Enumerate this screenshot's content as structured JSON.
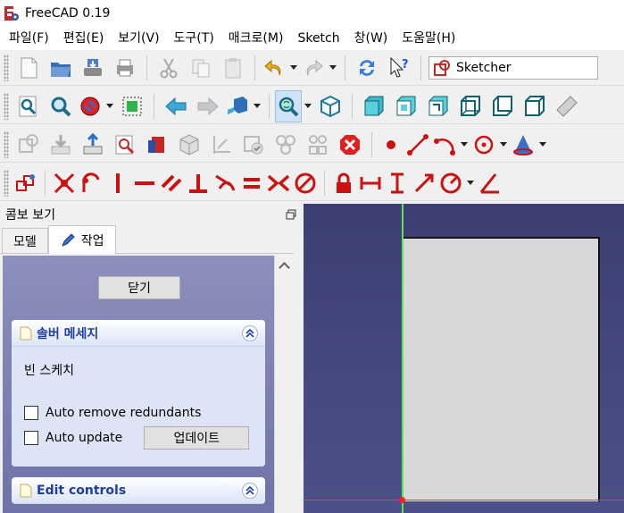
{
  "window": {
    "title": "FreeCAD 0.19"
  },
  "menu": [
    "파일(F)",
    "편집(E)",
    "보기(V)",
    "도구(T)",
    "매크로(M)",
    "Sketch",
    "창(W)",
    "도움말(H)"
  ],
  "workbench": {
    "selected": "Sketcher"
  },
  "combo_view": {
    "title": "콤보 보기",
    "tabs": [
      "모델",
      "작업"
    ],
    "active_tab": "작업"
  },
  "task": {
    "close_label": "닫기",
    "solver": {
      "title": "솔버 메세지",
      "status": "빈 스케치",
      "auto_remove_label": "Auto remove redundants",
      "auto_update_label": "Auto update",
      "update_label": "업데이트"
    },
    "edit_controls": {
      "title": "Edit controls"
    }
  },
  "colors": {
    "sketch_red": "#cc1111",
    "accent_blue": "#1f3ea3",
    "viewport_top": "#3d3f72",
    "viewport_bottom": "#4c5088",
    "axis_x": "#e84040",
    "axis_y": "#5fe05f"
  }
}
